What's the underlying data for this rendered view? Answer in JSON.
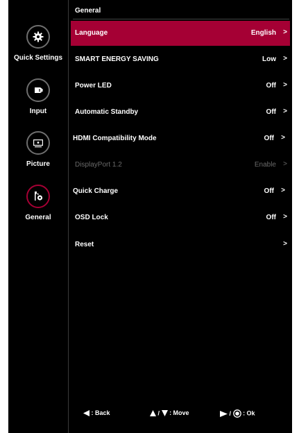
{
  "sidebar": {
    "items": [
      {
        "label": "Quick Settings",
        "icon": "gear-icon"
      },
      {
        "label": "Input",
        "icon": "input-plug-icon"
      },
      {
        "label": "Picture",
        "icon": "monitor-icon"
      },
      {
        "label": "General",
        "icon": "general-tools-icon",
        "active": true
      }
    ]
  },
  "main": {
    "title": "General",
    "rows": [
      {
        "label": "Language",
        "value": "English",
        "chevron": ">",
        "selected": true
      },
      {
        "label": "SMART ENERGY SAVING",
        "value": "Low",
        "chevron": ">"
      },
      {
        "label": "Power LED",
        "value": "Off",
        "chevron": ">"
      },
      {
        "label": "Automatic Standby",
        "value": "Off",
        "chevron": ">"
      },
      {
        "label": "HDMI Compatibility Mode",
        "value": "Off",
        "chevron": ">"
      },
      {
        "label": "DisplayPort 1.2",
        "value": "Enable",
        "chevron": ">",
        "disabled": true
      },
      {
        "label": "Quick Charge",
        "value": "Off",
        "chevron": ">"
      },
      {
        "label": "OSD Lock",
        "value": "Off",
        "chevron": ">"
      },
      {
        "label": "Reset",
        "value": "",
        "chevron": ">"
      }
    ]
  },
  "footer": {
    "back": ": Back",
    "move": ": Move",
    "ok": ": Ok"
  },
  "colors": {
    "accent": "#a50034",
    "background": "#000000",
    "disabled_text": "#6a6a6a"
  }
}
